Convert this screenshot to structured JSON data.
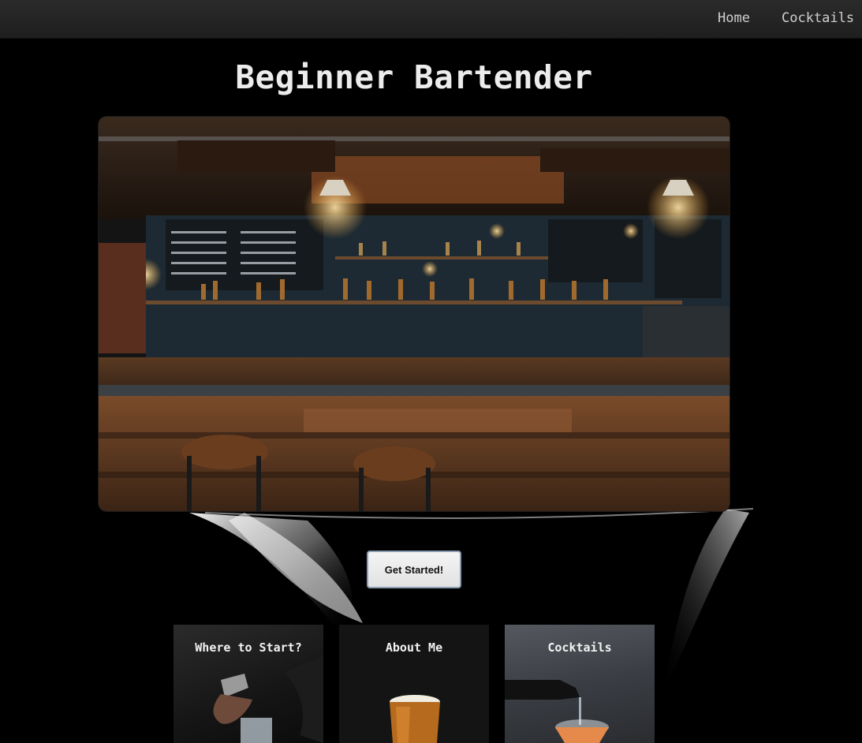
{
  "nav": {
    "home_label": "Home",
    "cocktails_label": "Cocktails"
  },
  "page": {
    "title": "Beginner Bartender"
  },
  "hero": {
    "image_alt_icon": "bar-interior-photo"
  },
  "cta": {
    "label": "Get Started!"
  },
  "cards": [
    {
      "title": "Where to Start?",
      "icon": "pouring-jigger-photo"
    },
    {
      "title": "About Me",
      "icon": "beer-glass-photo"
    },
    {
      "title": "Cocktails",
      "icon": "cocktail-pour-photo"
    }
  ]
}
